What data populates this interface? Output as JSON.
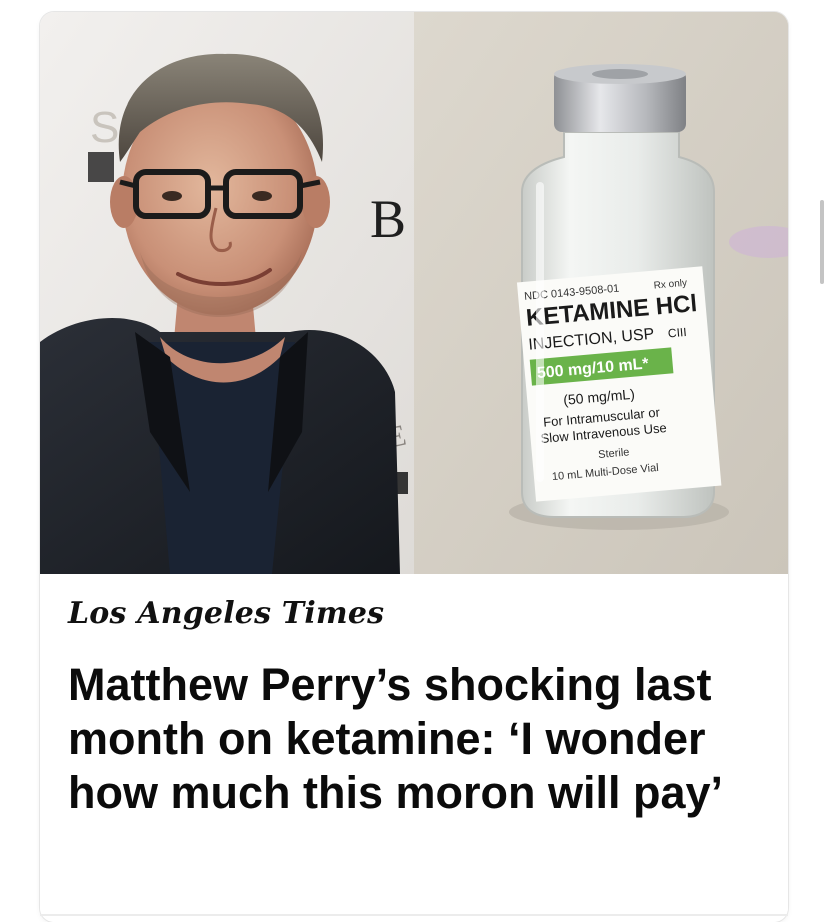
{
  "card": {
    "photo_left": {
      "backdrop_text": [
        "S",
        "B",
        "RE"
      ]
    },
    "photo_right": {
      "ndc": "NDC 0143-9508-01",
      "rx": "Rx only",
      "drug_name": "KETAMINE HCl",
      "injection": "INJECTION, USP",
      "schedule": "CIII",
      "strength": "500 mg/10 mL*",
      "concentration": "(50 mg/mL)",
      "route_line1": "For Intramuscular or",
      "route_line2": "Slow Intravenous Use",
      "sterile": "Sterile",
      "volume": "10 mL Multi-Dose Vial"
    },
    "source": "Los Angeles Times",
    "headline": "Matthew Perry’s shocking last month on ketamine: ‘I wonder how much this moron will pay’"
  },
  "colors": {
    "label_green": "#6ab34a",
    "text": "#0b0b0b",
    "backdrop_right": "#d6d1c6"
  }
}
